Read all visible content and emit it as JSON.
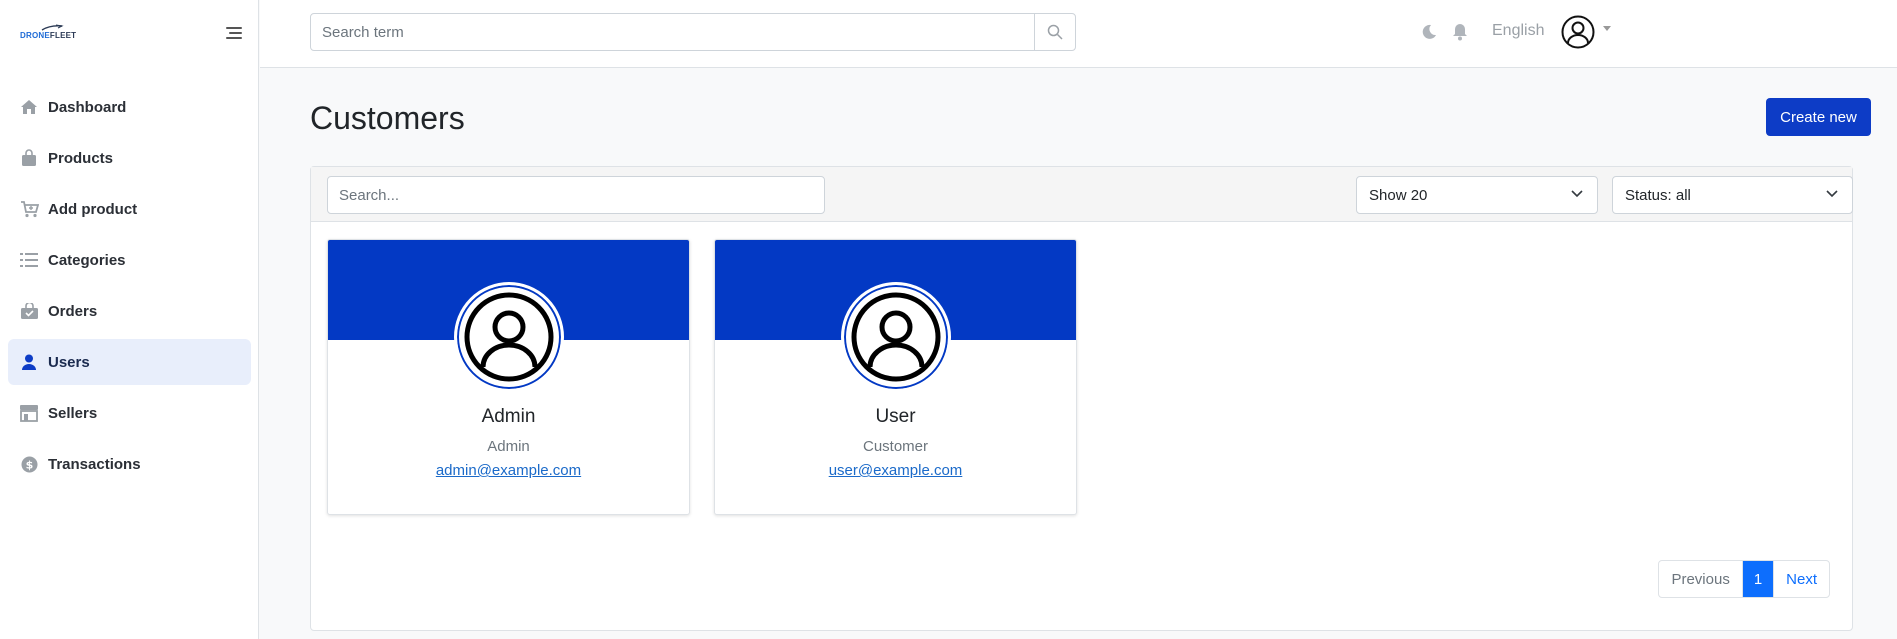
{
  "app": {
    "logo_part1": "DRONE",
    "logo_part2": "FLEET"
  },
  "sidebar": {
    "items": [
      {
        "label": "Dashboard",
        "icon": "home-icon"
      },
      {
        "label": "Products",
        "icon": "bag-icon"
      },
      {
        "label": "Add product",
        "icon": "cart-plus-icon"
      },
      {
        "label": "Categories",
        "icon": "list-icon"
      },
      {
        "label": "Orders",
        "icon": "bag-check-icon"
      },
      {
        "label": "Users",
        "icon": "person-icon",
        "active": true
      },
      {
        "label": "Sellers",
        "icon": "shop-icon"
      },
      {
        "label": "Transactions",
        "icon": "dollar-circle-icon"
      }
    ]
  },
  "topbar": {
    "search_placeholder": "Search term",
    "language": "English"
  },
  "page": {
    "title": "Customers",
    "create_label": "Create new"
  },
  "filters": {
    "search_placeholder": "Search...",
    "show_value": "Show 20",
    "status_value": "Status: all"
  },
  "cards": [
    {
      "name": "Admin",
      "role": "Admin",
      "email": "admin@example.com"
    },
    {
      "name": "User",
      "role": "Customer",
      "email": "user@example.com"
    }
  ],
  "pagination": {
    "previous": "Previous",
    "current": "1",
    "next": "Next"
  },
  "colors": {
    "primary": "#0d3cc6",
    "card_band": "#0339c4",
    "link": "#1b6ac9",
    "page_active": "#0d6efd"
  }
}
